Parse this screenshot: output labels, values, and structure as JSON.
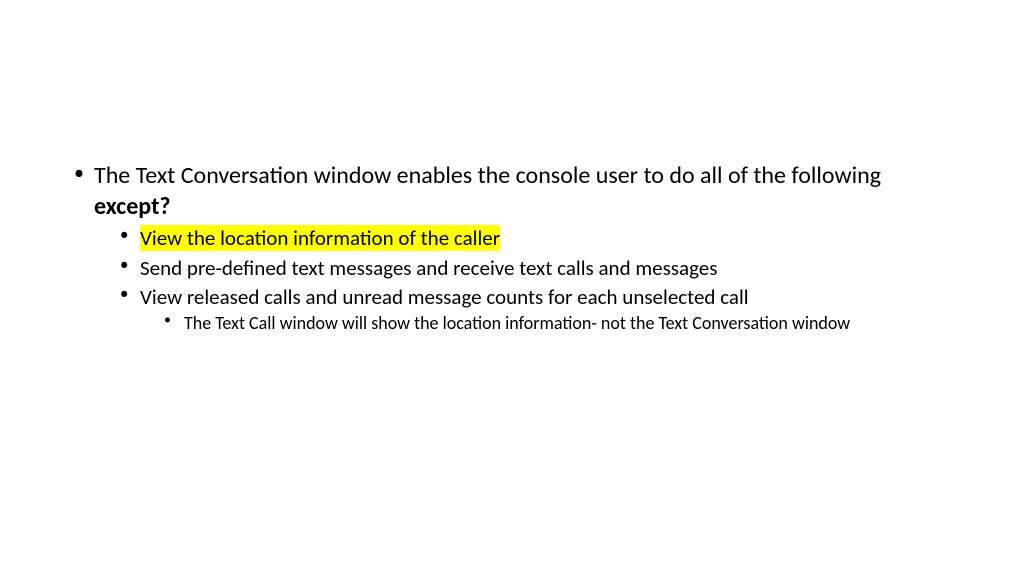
{
  "slide": {
    "question": {
      "stem": "The Text Conversation window enables the console user to do all of the following ",
      "emphasis": "except?"
    },
    "answers": [
      {
        "text": "View the location information of the caller",
        "highlighted": true
      },
      {
        "text": "Send pre-defined text messages and receive text calls and messages",
        "highlighted": false
      },
      {
        "text": "View released calls and unread message counts for each unselected call",
        "highlighted": false
      }
    ],
    "note": "The Text Call window will show the location information- not the Text Conversation window"
  }
}
